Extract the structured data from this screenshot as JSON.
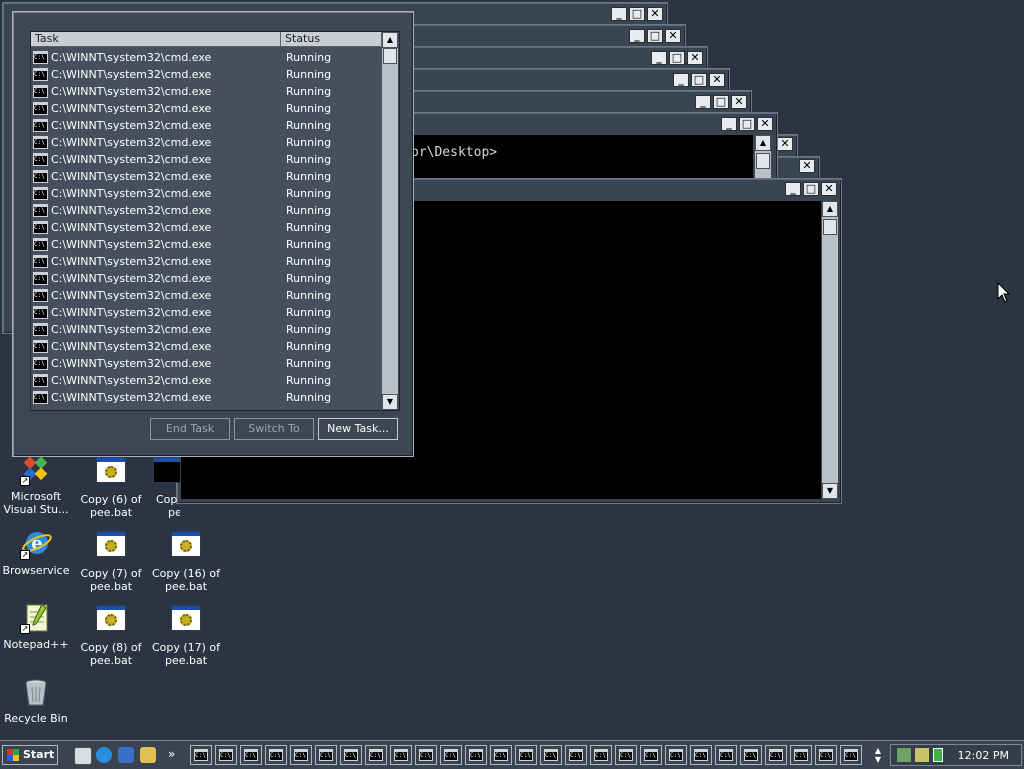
{
  "taskmgr": {
    "columns": [
      "Task",
      "Status"
    ],
    "task_name": "C:\\WINNT\\system32\\cmd.exe",
    "status": "Running",
    "rows": [
      {
        "task": "C:\\WINNT\\system32\\cmd.exe",
        "status": "Running"
      },
      {
        "task": "C:\\WINNT\\system32\\cmd.exe",
        "status": "Running"
      },
      {
        "task": "C:\\WINNT\\system32\\cmd.exe",
        "status": "Running"
      },
      {
        "task": "C:\\WINNT\\system32\\cmd.exe",
        "status": "Running"
      },
      {
        "task": "C:\\WINNT\\system32\\cmd.exe",
        "status": "Running"
      },
      {
        "task": "C:\\WINNT\\system32\\cmd.exe",
        "status": "Running"
      },
      {
        "task": "C:\\WINNT\\system32\\cmd.exe",
        "status": "Running"
      },
      {
        "task": "C:\\WINNT\\system32\\cmd.exe",
        "status": "Running"
      },
      {
        "task": "C:\\WINNT\\system32\\cmd.exe",
        "status": "Running"
      },
      {
        "task": "C:\\WINNT\\system32\\cmd.exe",
        "status": "Running"
      },
      {
        "task": "C:\\WINNT\\system32\\cmd.exe",
        "status": "Running"
      },
      {
        "task": "C:\\WINNT\\system32\\cmd.exe",
        "status": "Running"
      },
      {
        "task": "C:\\WINNT\\system32\\cmd.exe",
        "status": "Running"
      },
      {
        "task": "C:\\WINNT\\system32\\cmd.exe",
        "status": "Running"
      },
      {
        "task": "C:\\WINNT\\system32\\cmd.exe",
        "status": "Running"
      },
      {
        "task": "C:\\WINNT\\system32\\cmd.exe",
        "status": "Running"
      },
      {
        "task": "C:\\WINNT\\system32\\cmd.exe",
        "status": "Running"
      },
      {
        "task": "C:\\WINNT\\system32\\cmd.exe",
        "status": "Running"
      },
      {
        "task": "C:\\WINNT\\system32\\cmd.exe",
        "status": "Running"
      },
      {
        "task": "C:\\WINNT\\system32\\cmd.exe",
        "status": "Running"
      },
      {
        "task": "C:\\WINNT\\system32\\cmd.exe",
        "status": "Running"
      }
    ],
    "buttons": {
      "end_task": "End Task",
      "switch_to": "Switch To",
      "new_task": "New Task..."
    }
  },
  "console": {
    "prompt_fragment": "or\\Desktop>"
  },
  "window_buttons": {
    "minimize": "_",
    "maximize": "□",
    "close": "✕"
  },
  "desktop_icons": {
    "col1": [
      {
        "label1": "Microsoft",
        "label2": "Visual Stu...",
        "icon": "visual-studio-icon"
      },
      {
        "label1": "Browservice",
        "label2": "",
        "icon": "internet-explorer-icon"
      },
      {
        "label1": "Notepad++",
        "label2": "",
        "icon": "notepad-plus-plus-icon"
      },
      {
        "label1": "Recycle Bin",
        "label2": "",
        "icon": "recycle-bin-icon"
      }
    ],
    "col2": [
      {
        "label1": "Copy (6) of",
        "label2": "pee.bat",
        "icon": "batch-file-icon"
      },
      {
        "label1": "Copy (7) of",
        "label2": "pee.bat",
        "icon": "batch-file-icon"
      },
      {
        "label1": "Copy (8) of",
        "label2": "pee.bat",
        "icon": "batch-file-icon"
      }
    ],
    "col3": [
      {
        "label1": "Cop",
        "label2": "pee.bat",
        "icon": "batch-file-icon"
      },
      {
        "label1": "Copy (16) of",
        "label2": "pee.bat",
        "icon": "batch-file-icon"
      },
      {
        "label1": "Copy (17) of",
        "label2": "pee.bat",
        "icon": "batch-file-icon"
      }
    ]
  },
  "taskbar": {
    "start_label": "Start",
    "cmd_icon_text": "C:\\",
    "task_button_count": 27,
    "clock": "12:02 PM",
    "quicklaunch": [
      "show-desktop-icon",
      "internet-explorer-icon",
      "outlook-icon",
      "search-icon"
    ]
  },
  "colors": {
    "desktop": "#2a3442",
    "window": "#3a4553",
    "console": "#000000",
    "accent_blue": "#1a4fb0"
  }
}
